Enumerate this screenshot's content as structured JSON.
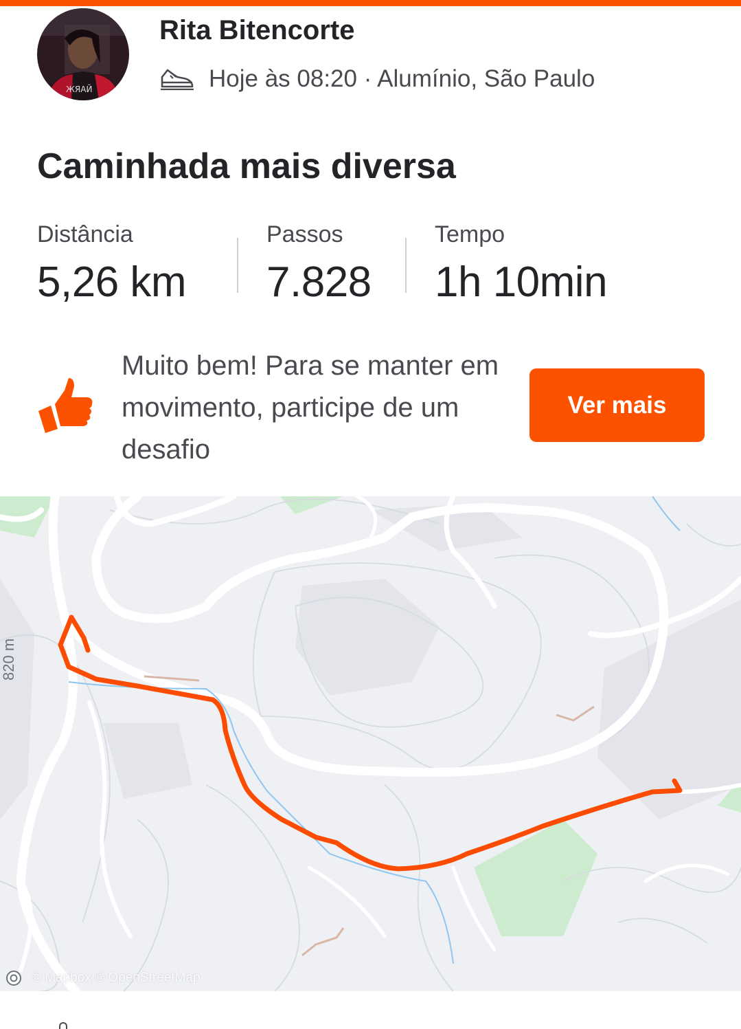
{
  "colors": {
    "accent": "#fc5200",
    "text_primary": "#242428",
    "text_secondary": "#494950",
    "map_background": "#eef0f4",
    "map_road": "#ffffff",
    "map_park": "#cdeccf",
    "map_water": "#8fc6f0",
    "route": "#fc4c02"
  },
  "header": {
    "athlete_name": "Rita Bitencorte",
    "activity_icon": "shoe-icon",
    "meta": "Hoje às 08:20 · Alumínio, São Paulo"
  },
  "activity": {
    "title": "Caminhada mais diversa",
    "stats": [
      {
        "label": "Distância",
        "value": "5,26 km"
      },
      {
        "label": "Passos",
        "value": "7.828"
      },
      {
        "label": "Tempo",
        "value": "1h 10min"
      }
    ]
  },
  "promo": {
    "icon": "thumbs-up-icon",
    "text": "Muito bem! Para se manter em movimento, participe de um desafio",
    "button_label": "Ver mais"
  },
  "map": {
    "elevation_label": "820 m",
    "attribution": "© Mapbox © OpenStreetMap",
    "logo_icon": "mapbox-logo-icon"
  }
}
